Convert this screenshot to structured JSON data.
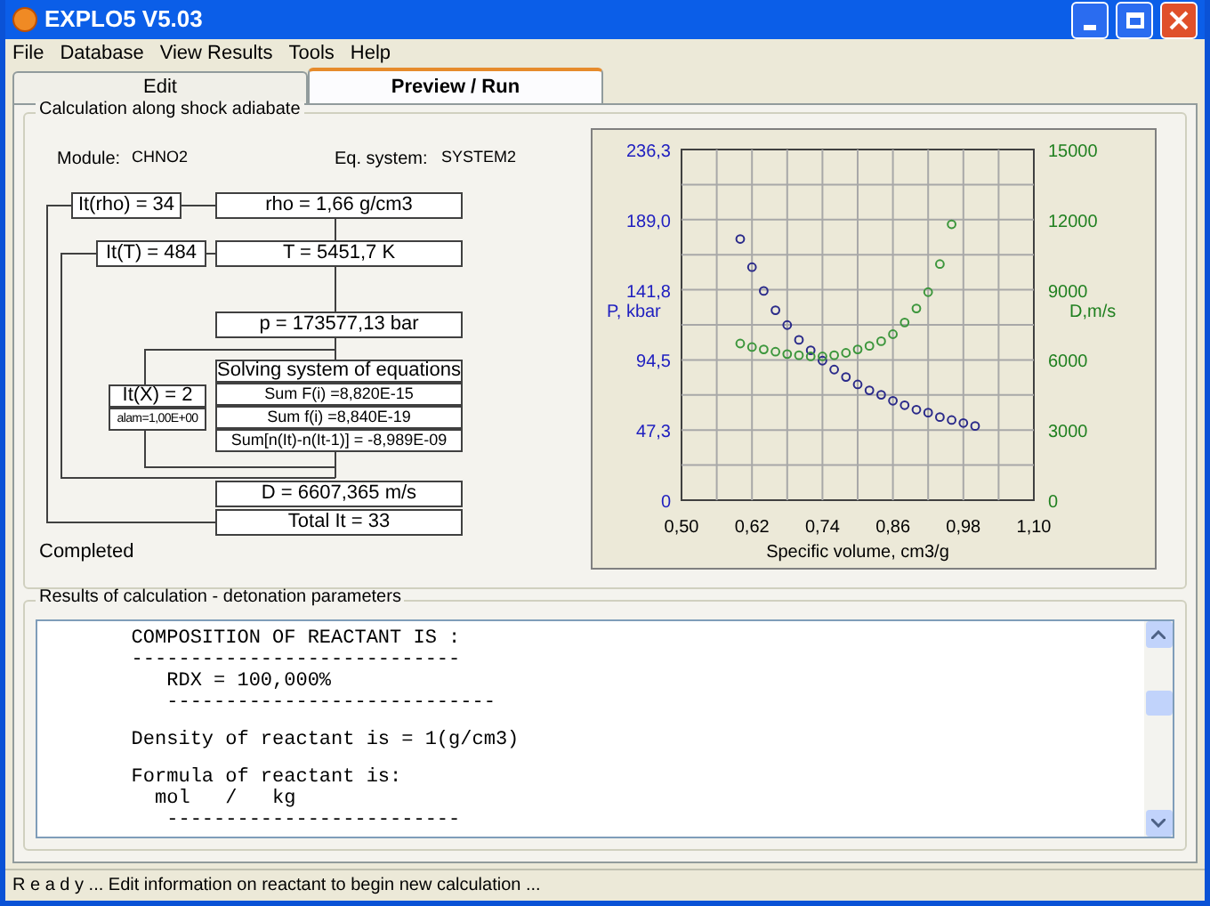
{
  "window": {
    "title": "EXPLO5 V5.03"
  },
  "menu": [
    "File",
    "Database",
    "View Results",
    "Tools",
    "Help"
  ],
  "tabs": [
    {
      "label": "Edit",
      "selected": false
    },
    {
      "label": "Preview / Run",
      "selected": true
    }
  ],
  "calculation": {
    "title": "Calculation along shock adiabate",
    "module_label": "Module:",
    "module": "CHNO2",
    "eq_label": "Eq. system:",
    "eq": "SYSTEM2",
    "it_rho": "It(rho) = 34",
    "rho": "rho = 1,66 g/cm3",
    "it_t": "It(T) = 484",
    "t": "T = 5451,7 K",
    "p": "p = 173577,13  bar",
    "solving": [
      "Solving system of equations",
      "Sum F(i) =8,820E-15",
      "Sum f(i) =8,840E-19",
      "Sum[n(It)-n(It-1)] = -8,989E-09"
    ],
    "it_x": "It(X) = 2",
    "alam": "alam=1,00E+00",
    "d": "D = 6607,365 m/s",
    "total": "Total It = 33",
    "status": "Completed",
    "chart_data": {
      "type": "scatter",
      "grid": true,
      "xlabel": "Specific volume, cm3/g",
      "ylabel": "P, kbar",
      "y2label": "D,m/s",
      "xlim": [
        0.5,
        1.1
      ],
      "ylim": [
        0,
        236.3
      ],
      "y2lim": [
        0,
        15000
      ],
      "xticks": [
        {
          "value": 0.5,
          "label": "0,50"
        },
        {
          "value": 0.62,
          "label": "0,62"
        },
        {
          "value": 0.74,
          "label": "0,74"
        },
        {
          "value": 0.86,
          "label": "0,86"
        },
        {
          "value": 0.98,
          "label": "0,98"
        },
        {
          "value": 1.1,
          "label": "1,10"
        }
      ],
      "yticks": [
        {
          "value": 0,
          "label": "0"
        },
        {
          "value": 47.3,
          "label": "47,3"
        },
        {
          "value": 94.5,
          "label": "94,5"
        },
        {
          "value": 141.8,
          "label": "141,8"
        },
        {
          "value": 189,
          "label": "189,0"
        },
        {
          "value": 236.3,
          "label": "236,3"
        }
      ],
      "y2ticks": [
        {
          "value": 0,
          "label": "0"
        },
        {
          "value": 3000,
          "label": "3000"
        },
        {
          "value": 6000,
          "label": "6000"
        },
        {
          "value": 9000,
          "label": "9000"
        },
        {
          "value": 12000,
          "label": "12000"
        },
        {
          "value": 15000,
          "label": "15000"
        }
      ],
      "x": [
        0.6,
        0.62,
        0.64,
        0.66,
        0.68,
        0.7,
        0.72,
        0.74,
        0.76,
        0.78,
        0.8,
        0.82,
        0.84,
        0.86,
        0.88,
        0.9,
        0.92,
        0.94,
        0.96,
        0.98,
        1.0
      ],
      "series": [
        {
          "color": "#2a2a8a",
          "values": [
            176,
            157,
            141,
            128,
            118,
            108,
            101,
            94,
            88,
            83,
            78,
            74,
            71,
            67,
            64,
            61,
            59,
            56,
            54,
            52,
            50
          ]
        },
        {
          "color": "#3c963c",
          "axis": "y2",
          "values": [
            6700,
            6550,
            6450,
            6350,
            6250,
            6200,
            6150,
            6150,
            6200,
            6300,
            6450,
            6600,
            6800,
            7100,
            7600,
            8200,
            8900,
            10100,
            11800,
            null,
            null
          ]
        }
      ]
    }
  },
  "results": {
    "title": "Results of calculation - detonation parameters",
    "paragraphs": [
      [
        "        COMPOSITION OF REACTANT IS :",
        "        ----------------------------",
        "           RDX = 100,000%",
        "           ----------------------------"
      ],
      [
        "        Density of reactant is = 1(g/cm3)"
      ],
      [
        "        Formula of reactant is:",
        "          mol   /   kg",
        "           -------------------------"
      ]
    ]
  },
  "status_bar": "R e a d y ... Edit information on reactant to begin new calculation ..."
}
